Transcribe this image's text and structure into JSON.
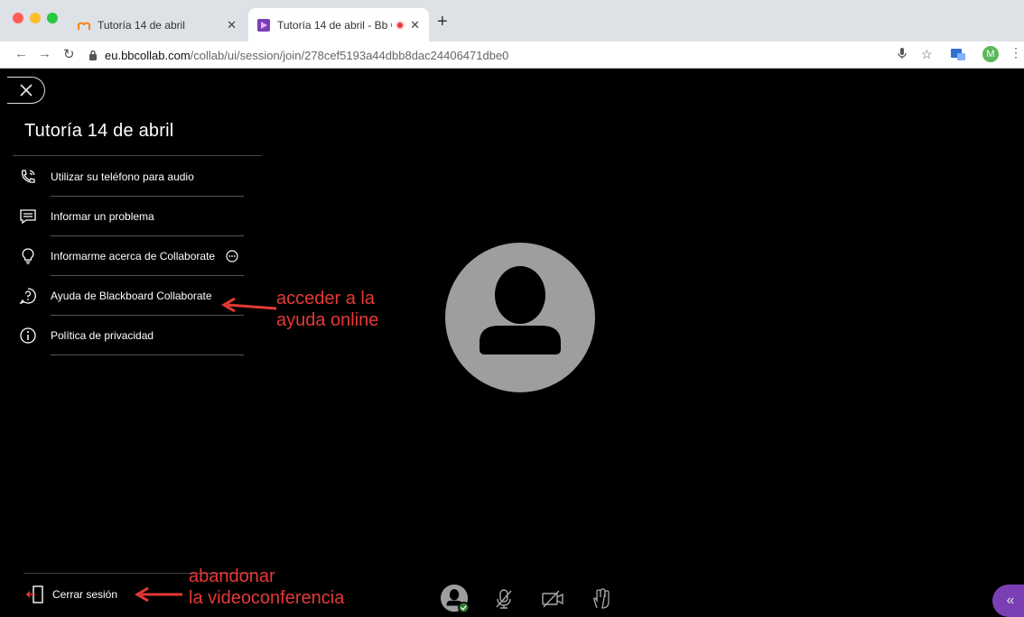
{
  "browser": {
    "tabs": [
      {
        "label": "Tutoría 14 de abril",
        "active": false
      },
      {
        "label": "Tutoría 14 de abril - Bb Col",
        "active": true
      }
    ],
    "new_tab": "+",
    "url_host": "eu.bbcollab.com",
    "url_path": "/collab/ui/session/join/278cef5193a44dbb8dac24406471dbe0",
    "profile_initial": "M",
    "colors": {
      "close": "#ff5f57",
      "minimize": "#febc2e",
      "maximize": "#28c840"
    }
  },
  "session": {
    "title": "Tutoría 14 de abril"
  },
  "menu": [
    {
      "label": "Utilizar su teléfono para audio",
      "icon": "phone-icon"
    },
    {
      "label": "Informar un problema",
      "icon": "report-icon"
    },
    {
      "label": "Informarme acerca de Collaborate",
      "icon": "lightbulb-icon"
    },
    {
      "label": "Ayuda de Blackboard Collaborate",
      "icon": "help-icon"
    },
    {
      "label": "Política de privacidad",
      "icon": "info-icon"
    }
  ],
  "logout": {
    "label": "Cerrar sesión"
  },
  "annotations": {
    "help": [
      "acceder a la",
      "ayuda online"
    ],
    "logout": [
      "abandonar",
      "la videoconferencia"
    ]
  },
  "accent": "#7b3fb5"
}
